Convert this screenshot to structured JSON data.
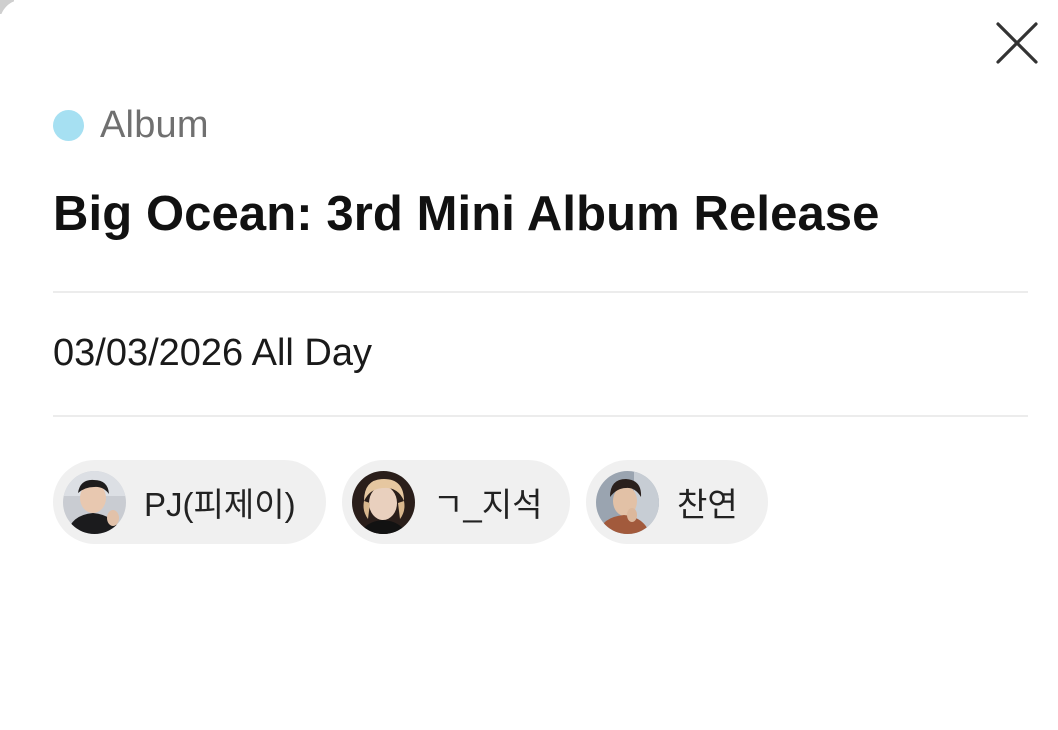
{
  "modal": {
    "category": {
      "label": "Album",
      "color": "#a6e0f2"
    },
    "title": "Big Ocean: 3rd Mini Album Release",
    "datetime": "03/03/2026 All Day",
    "close_icon": "close-icon",
    "members": [
      {
        "name": "PJ(피제이)",
        "avatar": "avatar-photo"
      },
      {
        "name": "ㄱ_지석",
        "avatar": "avatar-photo"
      },
      {
        "name": "찬연",
        "avatar": "avatar-photo"
      }
    ]
  }
}
